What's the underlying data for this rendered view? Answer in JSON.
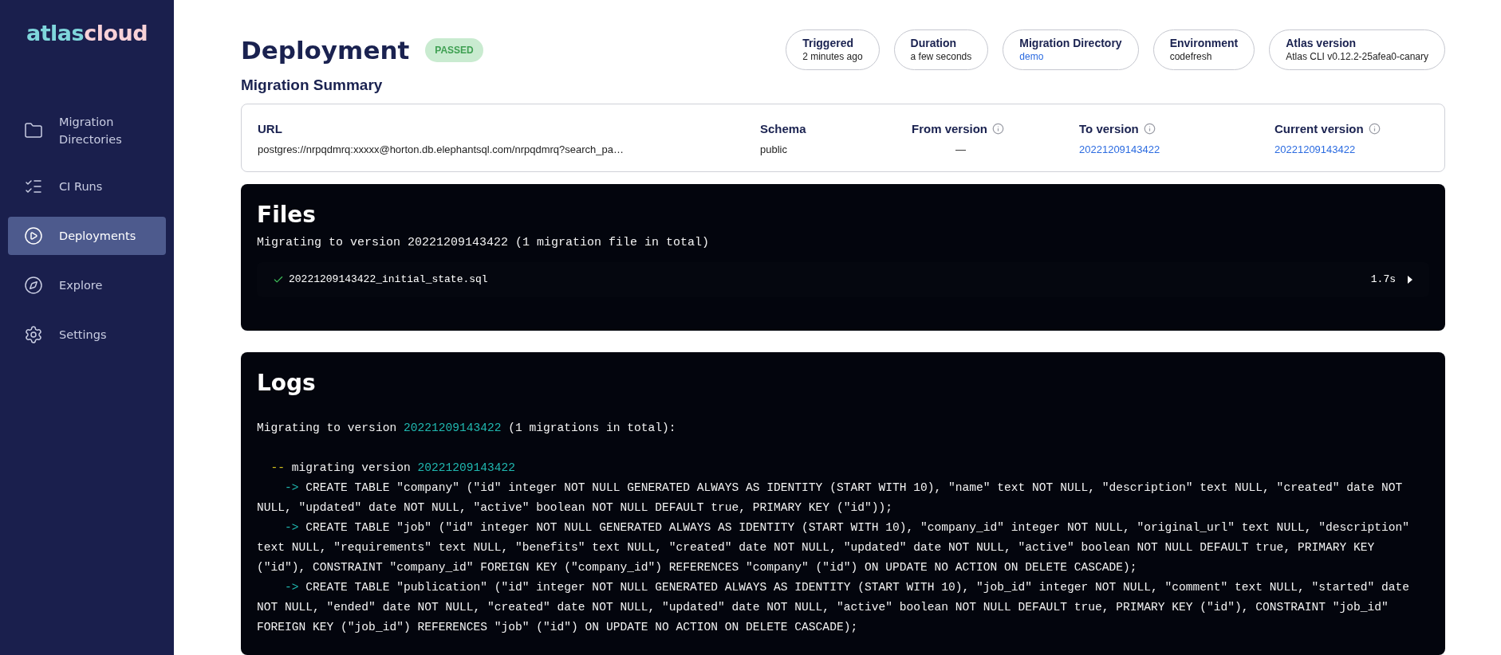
{
  "sidebar": {
    "logo": {
      "part_1": "atlas",
      "part_2": "cloud"
    },
    "items": [
      {
        "label": "Migration Directories",
        "selected": false
      },
      {
        "label": "CI Runs",
        "selected": false
      },
      {
        "label": "Deployments",
        "selected": true
      },
      {
        "label": "Explore",
        "selected": false
      },
      {
        "label": "Settings",
        "selected": false
      }
    ]
  },
  "header": {
    "title": "Deployment",
    "status": "PASSED",
    "facts": [
      {
        "label": "Triggered",
        "value": "2 minutes ago",
        "kind": "text"
      },
      {
        "label": "Duration",
        "value": "a few seconds",
        "kind": "text"
      },
      {
        "label": "Migration Directory",
        "value": "demo",
        "kind": "link"
      },
      {
        "label": "Environment",
        "value": "codefresh",
        "kind": "text"
      },
      {
        "label": "Atlas version",
        "value": "Atlas CLI v0.12.2-25afea0-canary",
        "kind": "text"
      }
    ]
  },
  "summary": {
    "title": "Migration Summary",
    "columns": [
      {
        "label": "URL",
        "value": "postgres://nrpqdmrq:xxxxx@horton.db.elephantsql.com/nrpqdmrq?search_pa…",
        "kind": "text",
        "info": false
      },
      {
        "label": "Schema",
        "value": "public",
        "kind": "text",
        "info": false
      },
      {
        "label": "From version",
        "value": "—",
        "kind": "center",
        "info": true
      },
      {
        "label": "To version",
        "value": "20221209143422",
        "kind": "link",
        "info": true
      },
      {
        "label": "Current version",
        "value": "20221209143422",
        "kind": "link",
        "info": true
      }
    ]
  },
  "files": {
    "title": "Files",
    "subtitle": "Migrating to version 20221209143422 (1 migration file in total)",
    "items": [
      {
        "name": "20221209143422_initial_state.sql",
        "passed": true,
        "duration": "1.7s"
      }
    ]
  },
  "logs": {
    "title": "Logs",
    "intro": {
      "before": "Migrating to version ",
      "version": "20221209143422",
      "after": " (1 migrations in total):"
    },
    "step": {
      "marker": "--",
      "label": " migrating version ",
      "version": "20221209143422"
    },
    "statements": [
      {
        "arrow": "->",
        "sql": "CREATE TABLE \"company\" (\"id\" integer NOT NULL GENERATED ALWAYS AS IDENTITY (START WITH 10), \"name\" text NOT NULL, \"description\" text NULL, \"created\" date NOT NULL, \"updated\" date NOT NULL, \"active\" boolean NOT NULL DEFAULT true, PRIMARY KEY (\"id\"));"
      },
      {
        "arrow": "->",
        "sql": "CREATE TABLE \"job\" (\"id\" integer NOT NULL GENERATED ALWAYS AS IDENTITY (START WITH 10), \"company_id\" integer NOT NULL, \"original_url\" text NULL, \"description\" text NULL, \"requirements\" text NULL, \"benefits\" text NULL, \"created\" date NOT NULL, \"updated\" date NOT NULL, \"active\" boolean NOT NULL DEFAULT true, PRIMARY KEY (\"id\"), CONSTRAINT \"company_id\" FOREIGN KEY (\"company_id\") REFERENCES \"company\" (\"id\") ON UPDATE NO ACTION ON DELETE CASCADE);"
      },
      {
        "arrow": "->",
        "sql": "CREATE TABLE \"publication\" (\"id\" integer NOT NULL GENERATED ALWAYS AS IDENTITY (START WITH 10), \"job_id\" integer NOT NULL, \"comment\" text NULL, \"started\" date NOT NULL, \"ended\" date NOT NULL, \"created\" date NOT NULL, \"updated\" date NOT NULL, \"active\" boolean NOT NULL DEFAULT true, PRIMARY KEY (\"id\"), CONSTRAINT \"job_id\" FOREIGN KEY (\"job_id\") REFERENCES \"job\" (\"id\") ON UPDATE NO ACTION ON DELETE CASCADE);"
      }
    ]
  }
}
